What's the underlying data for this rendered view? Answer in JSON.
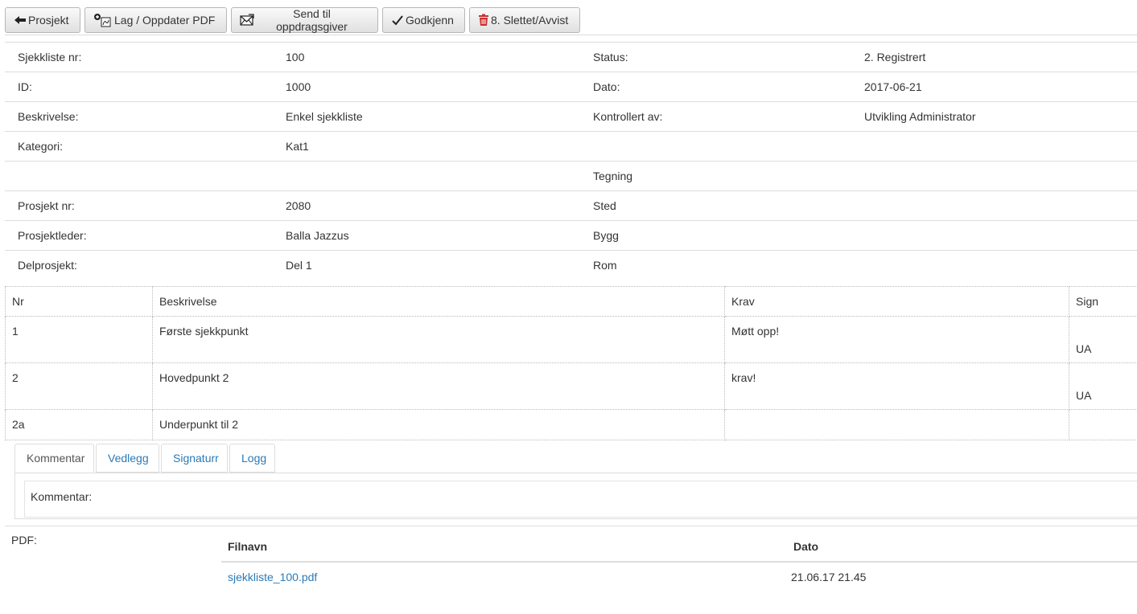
{
  "toolbar": {
    "back_label": "Prosjekt",
    "pdf_label": "Lag / Oppdater PDF",
    "send_label": "Send til oppdragsgiver",
    "approve_label": "Godkjenn",
    "delete_label": "8. Slettet/Avvist"
  },
  "info": {
    "rows": [
      {
        "l1": "Sjekkliste nr:",
        "v1": "100",
        "l2": "Status:",
        "v2": "2. Registrert"
      },
      {
        "l1": "ID:",
        "v1": "1000",
        "l2": "Dato:",
        "v2": "2017-06-21"
      },
      {
        "l1": "Beskrivelse:",
        "v1": "Enkel sjekkliste",
        "l2": "Kontrollert av:",
        "v2": "Utvikling Administrator"
      },
      {
        "l1": "Kategori:",
        "v1": "Kat1",
        "l2": "",
        "v2": ""
      },
      {
        "l1": "",
        "v1": "",
        "l2": "Tegning",
        "v2": ""
      },
      {
        "l1": "Prosjekt nr:",
        "v1": "2080",
        "l2": "Sted",
        "v2": ""
      },
      {
        "l1": "Prosjektleder:",
        "v1": "Balla Jazzus",
        "l2": "Bygg",
        "v2": ""
      },
      {
        "l1": "Delprosjekt:",
        "v1": "Del 1",
        "l2": "Rom",
        "v2": ""
      }
    ]
  },
  "checklist": {
    "headers": [
      "Nr",
      "Beskrivelse",
      "Krav",
      "Sign"
    ],
    "rows": [
      {
        "nr": "1",
        "desc": "Første sjekkpunkt",
        "krav": "Møtt opp!",
        "sign": "UA"
      },
      {
        "nr": "2",
        "desc": "Hovedpunkt 2",
        "krav": "krav!",
        "sign": "UA"
      },
      {
        "nr": "2a",
        "desc": "Underpunkt til 2",
        "krav": "",
        "sign": ""
      }
    ]
  },
  "tabs": [
    "Kommentar",
    "Vedlegg",
    "Signaturr",
    "Logg"
  ],
  "comment": {
    "label": "Kommentar:"
  },
  "pdf": {
    "label": "PDF:",
    "headers": [
      "Filnavn",
      "Dato"
    ],
    "files": [
      {
        "name": "sjekkliste_100.pdf",
        "date": "21.06.17 21.45"
      }
    ]
  },
  "colors": {
    "link": "#2a7ab8",
    "delete_icon": "#c9302c",
    "border": "#dddddd"
  }
}
